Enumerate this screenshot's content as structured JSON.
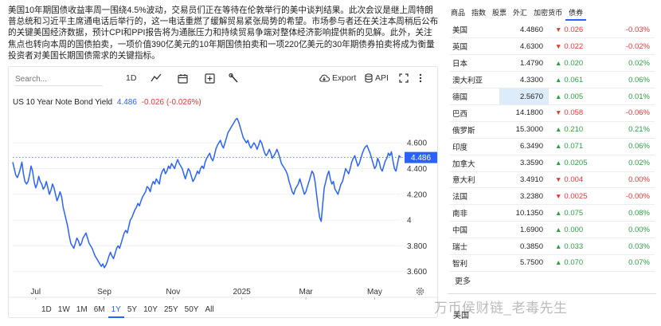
{
  "article": {
    "text": "美国10年期国债收益率周一围绕4.5%波动，交易员们正在等待在伦敦举行的美中谈判结果。此次会议是继上周特朗普总统和习近平主席通电话后举行的，这一电话重燃了缓解贸易紧张局势的希望。市场参与者还在关注本周稍后公布的关键美国经济数据，预计CPI和PPI报告将为通胀压力和持续贸易争端对整体经济影响提供新的见解。此外，关注焦点也转向本周的国债拍卖，一项价值390亿美元的10年期国债拍卖和一项220亿美元的30年期债券拍卖将成为衡量投资者对美国长期国债需求的关键指标。"
  },
  "toolbar": {
    "search_placeholder": "Search...",
    "interval": "1D",
    "export_label": "Export",
    "api_label": "API"
  },
  "legend": {
    "name": "US 10 Year Note Bond Yield",
    "price": "4.486",
    "change": "-0.026 (-0.026%)"
  },
  "colors": {
    "line": "#2962ff",
    "up": "#2e9e44",
    "down": "#e53935",
    "highlight": "#dcecfa"
  },
  "chart_data": {
    "type": "line",
    "title": "US 10 Year Note Bond Yield",
    "y_ticks": [
      "4.600",
      "4.400",
      "4.200",
      "4",
      "3.800",
      "3.600"
    ],
    "y_tick_values": [
      4.6,
      4.4,
      4.2,
      4.0,
      3.8,
      3.6
    ],
    "ylim": [
      3.53,
      4.88
    ],
    "x_ticks": [
      "Jul",
      "Sep",
      "Nov",
      "2025",
      "Mar",
      "May"
    ],
    "x_tick_index": [
      15,
      60,
      105,
      150,
      192,
      237
    ],
    "last_value_label": "4.486",
    "last_value": 4.486,
    "series": [
      {
        "values": [
          4.45,
          4.4,
          4.35,
          4.33,
          4.36,
          4.4,
          4.45,
          4.36,
          4.3,
          4.28,
          4.3,
          4.35,
          4.42,
          4.38,
          4.3,
          4.25,
          4.28,
          4.34,
          4.3,
          4.28,
          4.24,
          4.26,
          4.3,
          4.25,
          4.2,
          4.23,
          4.28,
          4.25,
          4.2,
          4.15,
          4.18,
          4.22,
          4.18,
          4.1,
          4.05,
          4.0,
          3.95,
          3.88,
          3.82,
          3.8,
          3.78,
          3.82,
          3.86,
          3.84,
          3.8,
          3.82,
          3.86,
          3.88,
          3.9,
          3.86,
          3.82,
          3.8,
          3.78,
          3.75,
          3.72,
          3.7,
          3.68,
          3.66,
          3.64,
          3.66,
          3.63,
          3.65,
          3.68,
          3.72,
          3.75,
          3.72,
          3.7,
          3.74,
          3.78,
          3.8,
          3.78,
          3.82,
          3.86,
          3.9,
          3.92,
          3.9,
          3.95,
          4.0,
          4.02,
          4.05,
          4.08,
          4.1,
          4.13,
          4.11,
          4.15,
          4.18,
          4.2,
          4.22,
          4.26,
          4.25,
          4.22,
          4.27,
          4.3,
          4.28,
          4.32,
          4.3,
          4.28,
          4.35,
          4.38,
          4.4,
          4.36,
          4.38,
          4.42,
          4.4,
          4.44,
          4.42,
          4.4,
          4.44,
          4.47,
          4.44,
          4.42,
          4.4,
          4.36,
          4.32,
          4.36,
          4.4,
          4.38,
          4.34,
          4.3,
          4.32,
          4.35,
          4.38,
          4.36,
          4.4,
          4.42,
          4.4,
          4.45,
          4.48,
          4.5,
          4.52,
          4.48,
          4.46,
          4.5,
          4.55,
          4.58,
          4.6,
          4.62,
          4.58,
          4.56,
          4.6,
          4.64,
          4.68,
          4.7,
          4.72,
          4.74,
          4.76,
          4.78,
          4.79,
          4.76,
          4.72,
          4.68,
          4.64,
          4.62,
          4.6,
          4.62,
          4.58,
          4.56,
          4.58,
          4.6,
          4.58,
          4.55,
          4.58,
          4.62,
          4.6,
          4.56,
          4.52,
          4.5,
          4.52,
          4.55,
          4.52,
          4.48,
          4.5,
          4.52,
          4.55,
          4.52,
          4.48,
          4.44,
          4.42,
          4.4,
          4.38,
          4.35,
          4.3,
          4.26,
          4.22,
          4.2,
          4.24,
          4.26,
          4.28,
          4.32,
          4.28,
          4.24,
          4.2,
          4.22,
          4.26,
          4.3,
          4.34,
          4.38,
          4.36,
          4.3,
          4.2,
          4.1,
          4.02,
          3.99,
          4.12,
          4.25,
          4.3,
          4.35,
          4.38,
          4.32,
          4.28,
          4.3,
          4.24,
          4.22,
          4.2,
          4.24,
          4.28,
          4.3,
          4.35,
          4.4,
          4.38,
          4.36,
          4.4,
          4.45,
          4.48,
          4.5,
          4.46,
          4.42,
          4.44,
          4.48,
          4.52,
          4.55,
          4.57,
          4.58,
          4.55,
          4.52,
          4.48,
          4.44,
          4.4,
          4.42,
          4.48,
          4.45,
          4.4,
          4.38,
          4.42,
          4.46,
          4.48,
          4.52,
          4.5,
          4.53,
          4.46,
          4.4,
          4.38,
          4.44,
          4.5,
          4.486
        ]
      }
    ]
  },
  "ranges": {
    "items": [
      "1D",
      "1W",
      "1M",
      "6M",
      "1Y",
      "5Y",
      "10Y",
      "25Y",
      "50Y",
      "All"
    ],
    "active": "1Y"
  },
  "panel": {
    "tabs": [
      "商品",
      "指数",
      "股票",
      "外汇",
      "加密货币",
      "债券"
    ],
    "active_tab": "债券",
    "rows": [
      {
        "country": "美国",
        "price": "4.4860",
        "change": "0.026",
        "dir": "down",
        "pct": "-0.03%"
      },
      {
        "country": "英国",
        "price": "4.6300",
        "change": "0.022",
        "dir": "down",
        "pct": "-0.02%"
      },
      {
        "country": "日本",
        "price": "1.4790",
        "change": "0.020",
        "dir": "up",
        "pct": "0.02%"
      },
      {
        "country": "澳大利亚",
        "price": "4.3300",
        "change": "0.061",
        "dir": "up",
        "pct": "0.06%"
      },
      {
        "country": "德国",
        "price": "2.5670",
        "change": "0.005",
        "dir": "up",
        "pct": "0.01%",
        "highlight": true
      },
      {
        "country": "巴西",
        "price": "14.1800",
        "change": "0.058",
        "dir": "down",
        "pct": "-0.06%"
      },
      {
        "country": "俄罗斯",
        "price": "15.3000",
        "change": "0.210",
        "dir": "up",
        "pct": "0.21%"
      },
      {
        "country": "印度",
        "price": "6.3490",
        "change": "0.071",
        "dir": "up",
        "pct": "0.06%"
      },
      {
        "country": "加拿大",
        "price": "3.3590",
        "change": "0.0205",
        "dir": "up",
        "pct": "0.02%"
      },
      {
        "country": "意大利",
        "price": "3.4910",
        "change": "0.004",
        "dir": "down",
        "pct": "0.00%"
      },
      {
        "country": "法国",
        "price": "3.2380",
        "change": "0.0025",
        "dir": "down",
        "pct": "-0.00%"
      },
      {
        "country": "南非",
        "price": "10.1350",
        "change": "0.075",
        "dir": "up",
        "pct": "0.08%"
      },
      {
        "country": "中国",
        "price": "1.6900",
        "change": "0.000",
        "dir": "up",
        "pct": "0.00%"
      },
      {
        "country": "瑞士",
        "price": "0.3850",
        "change": "0.033",
        "dir": "up",
        "pct": "0.03%"
      },
      {
        "country": "智利",
        "price": "5.7500",
        "change": "0.070",
        "dir": "up",
        "pct": "0.07%"
      }
    ],
    "more_label": "更多",
    "stub_label": "美国"
  },
  "watermark": "万币侯财链_老毒先生"
}
